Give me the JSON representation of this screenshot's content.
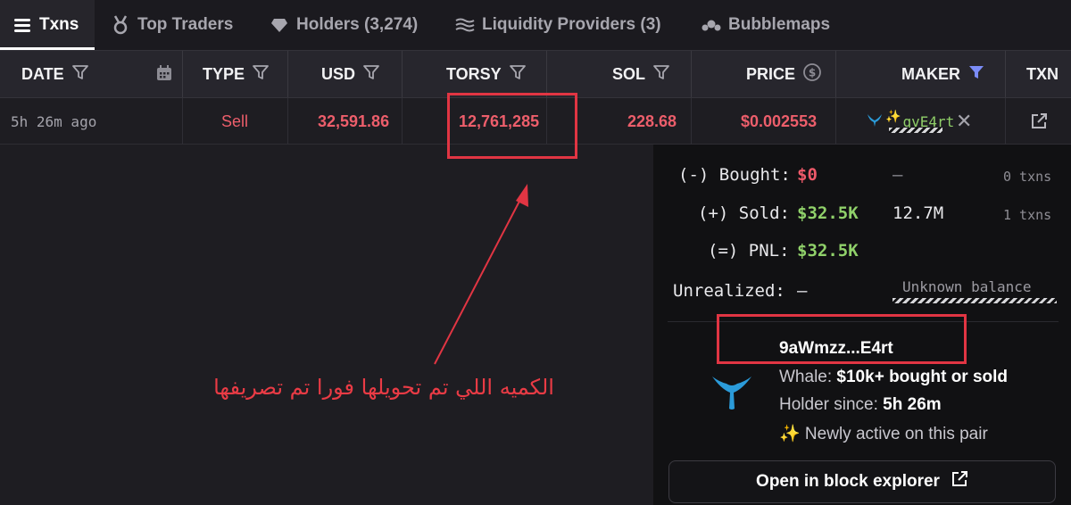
{
  "tabs": [
    {
      "label": "Txns",
      "icon": "menu-lines-icon"
    },
    {
      "label": "Top Traders",
      "icon": "medal-icon"
    },
    {
      "label": "Holders (3,274)",
      "icon": "diamond-icon"
    },
    {
      "label": "Liquidity Providers (3)",
      "icon": "waves-icon"
    },
    {
      "label": "Bubblemaps",
      "icon": "bubbles-icon"
    }
  ],
  "columns": {
    "date": "DATE",
    "type": "TYPE",
    "usd": "USD",
    "torsy": "TORSY",
    "sol": "SOL",
    "price": "PRICE",
    "maker": "MAKER",
    "txn": "TXN"
  },
  "row": {
    "date": "5h 26m ago",
    "type": "Sell",
    "usd": "32,591.86",
    "torsy": "12,761,285",
    "sol": "228.68",
    "price": "$0.002553",
    "maker": "qvE4rt"
  },
  "popup": {
    "bought_label": "(-) Bought:",
    "bought_value": "$0",
    "bought_amount": "–",
    "bought_txns": "0 txns",
    "sold_label": "(+) Sold:",
    "sold_value": "$32.5K",
    "sold_amount": "12.7M",
    "sold_txns": "1 txns",
    "pnl_label": "(=) PNL:",
    "pnl_value": "$32.5K",
    "unrealized_label": "Unrealized:",
    "unrealized_value": "–",
    "unknown_balance": "Unknown balance",
    "address": "9aWmzz...E4rt",
    "whale_label": "Whale:",
    "whale_value": "$10k+ bought or sold",
    "holder_label": "Holder since:",
    "holder_value": "5h 26m",
    "newly_active": "✨ Newly active on this pair",
    "explorer_button": "Open in block explorer"
  },
  "annotation": {
    "text": "الكميه اللي تم تحويلها فورا تم تصريفها",
    "color": "#e13543"
  },
  "colors": {
    "sell": "#ed5e6b",
    "positive": "#90d16a",
    "filter_active": "#7b8cf7",
    "background": "#1e1d22"
  }
}
